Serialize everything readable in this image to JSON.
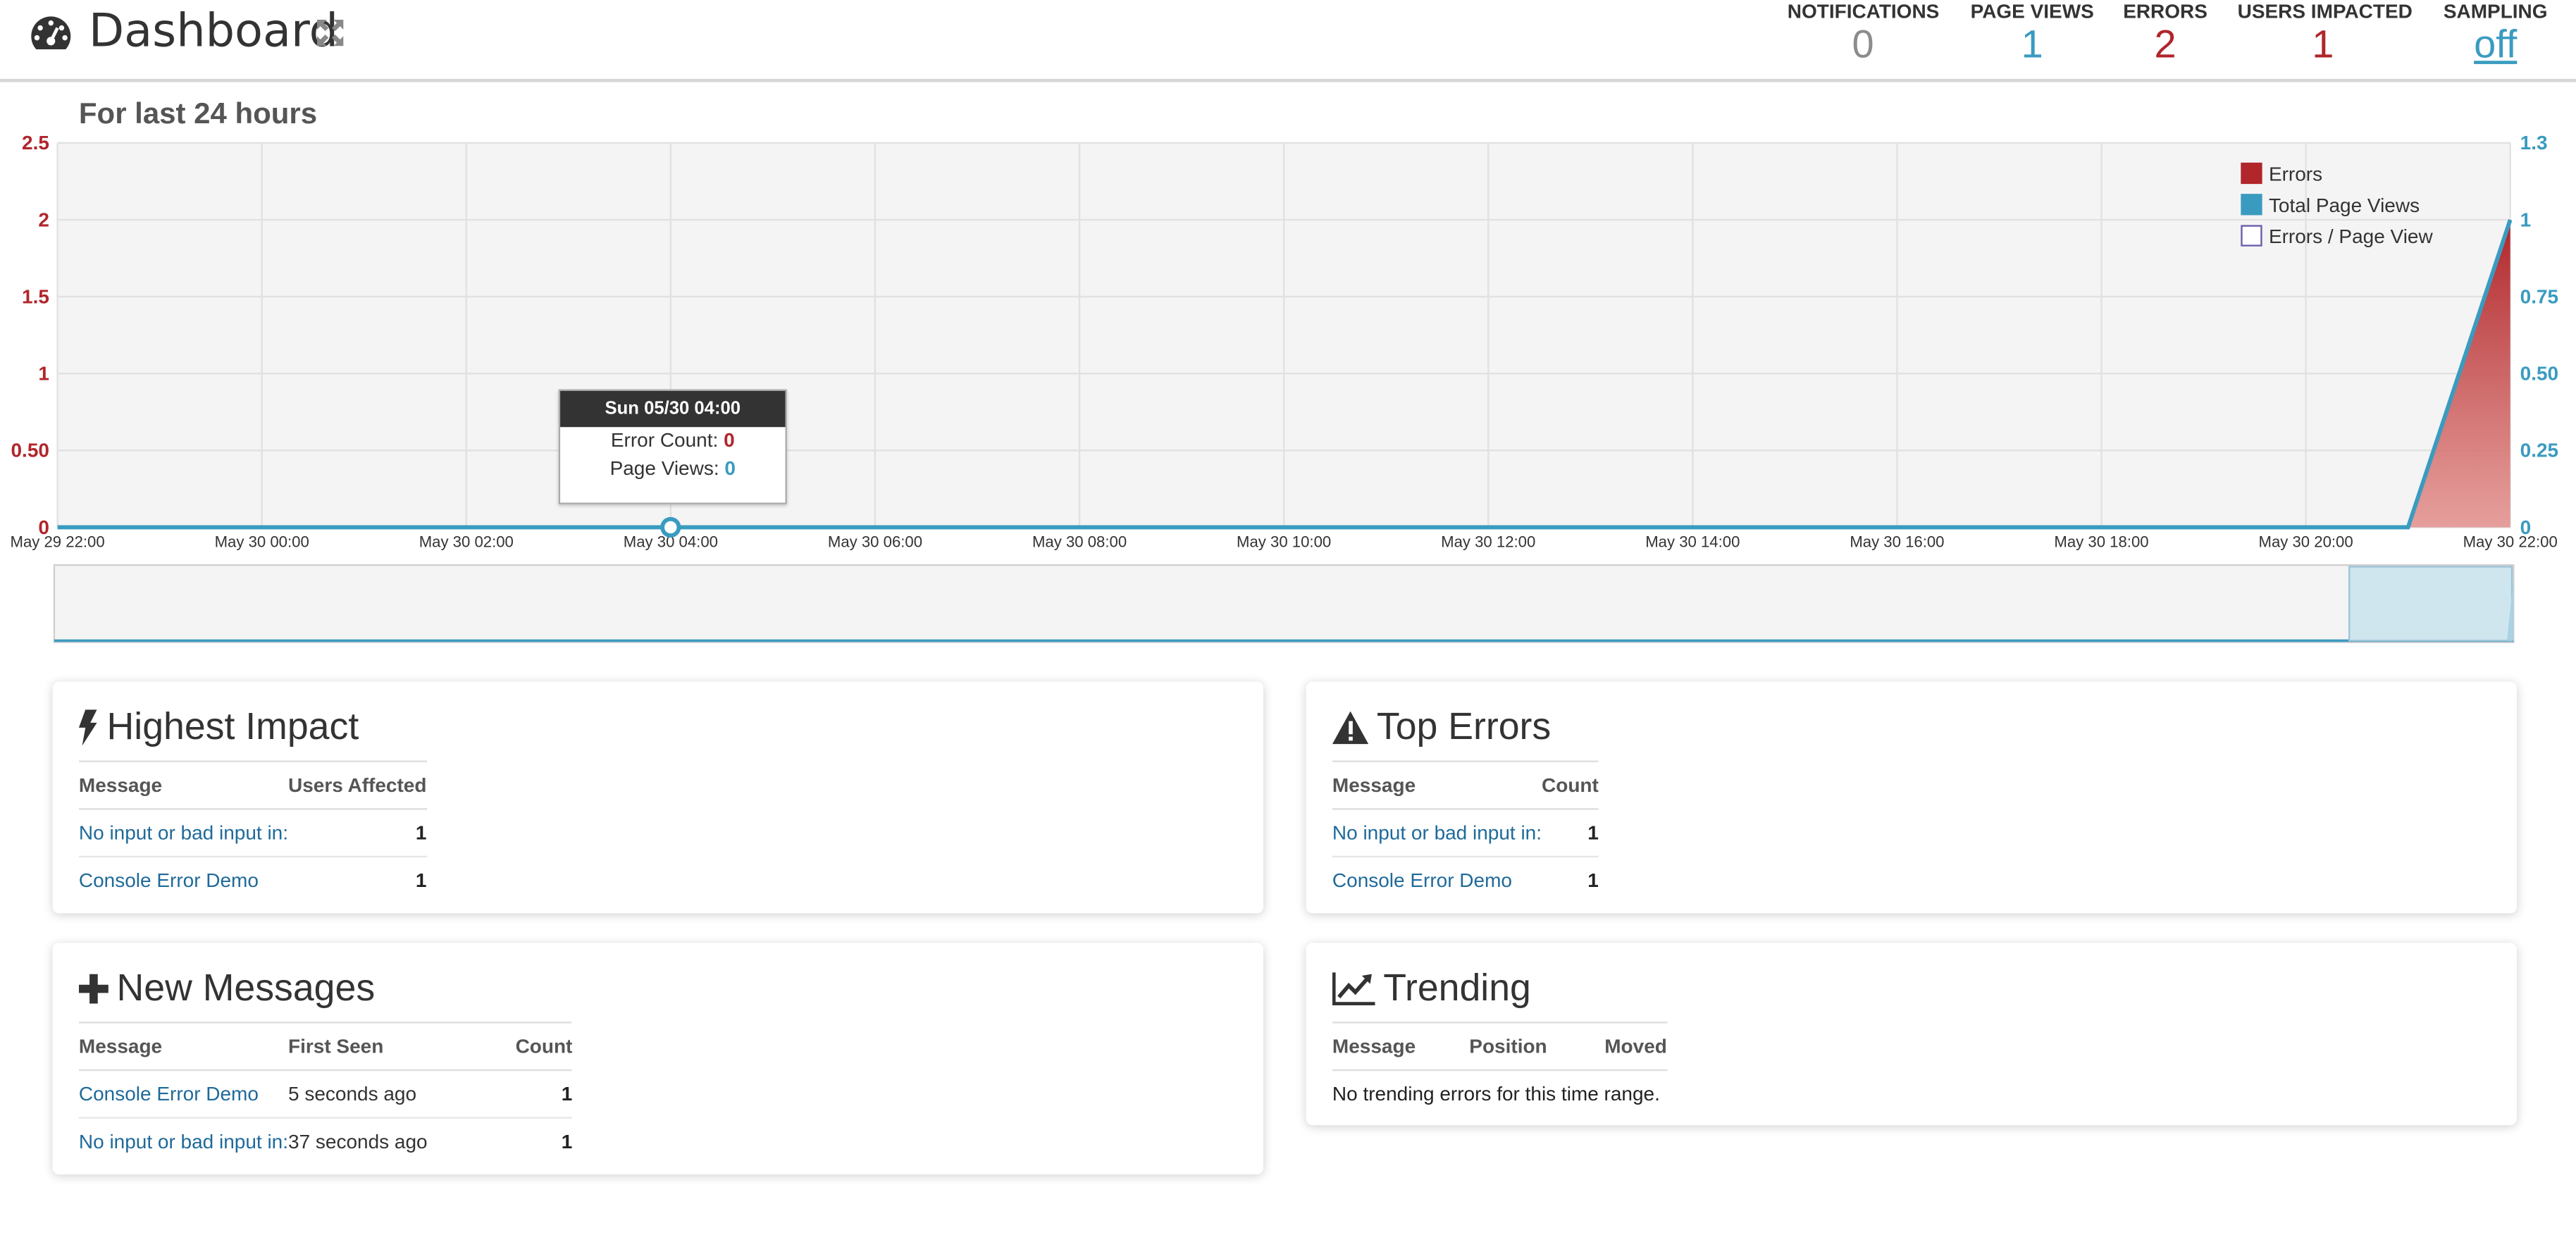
{
  "header": {
    "title": "Dashboard",
    "stats": [
      {
        "label": "NOTIFICATIONS",
        "value": "0"
      },
      {
        "label": "PAGE VIEWS",
        "value": "1"
      },
      {
        "label": "ERRORS",
        "value": "2"
      },
      {
        "label": "USERS IMPACTED",
        "value": "1"
      },
      {
        "label": "SAMPLING",
        "value": "off"
      }
    ],
    "colors": {
      "grey": "#8c8c8c",
      "blue": "#3a9bc0",
      "red": "#b0262b"
    }
  },
  "chart": {
    "title": "For last 24 hours",
    "legend": [
      "Errors",
      "Total Page Views",
      "Errors / Page View"
    ],
    "tooltip": {
      "title": "Sun 05/30 04:00",
      "error_label": "Error Count:",
      "error_value": "0",
      "pv_label": "Page Views:",
      "pv_value": "0"
    }
  },
  "chart_data": {
    "type": "area",
    "x": [
      "May 29 22:00",
      "May 30 00:00",
      "May 30 02:00",
      "May 30 04:00",
      "May 30 06:00",
      "May 30 08:00",
      "May 30 10:00",
      "May 30 12:00",
      "May 30 14:00",
      "May 30 16:00",
      "May 30 18:00",
      "May 30 20:00",
      "May 30 22:00"
    ],
    "x_ticks": [
      "May 29 22:00",
      "May 30 00:00",
      "May 30 02:00",
      "May 30 04:00",
      "May 30 06:00",
      "May 30 08:00",
      "May 30 10:00",
      "May 30 12:00",
      "May 30 14:00",
      "May 30 16:00",
      "May 30 18:00",
      "May 30 20:00",
      "May 30 22:00"
    ],
    "y_left_ticks": [
      "0",
      "0.50",
      "1",
      "1.5",
      "2",
      "2.5"
    ],
    "y_right_ticks": [
      "0",
      "0.25",
      "0.50",
      "0.75",
      "1",
      "1.3"
    ],
    "ylim_left": [
      0,
      2.5
    ],
    "ylim_right": [
      0,
      1.25
    ],
    "points_hours": [
      0,
      23,
      24
    ],
    "series": [
      {
        "name": "Errors",
        "axis": "left",
        "color": "#b0262b",
        "values": [
          0,
          0,
          2
        ]
      },
      {
        "name": "Total Page Views",
        "axis": "right",
        "color": "#3a9bc0",
        "values": [
          0,
          0,
          1
        ]
      },
      {
        "name": "Errors / Page View",
        "axis": "right",
        "color": "#6a5aa8",
        "values": []
      }
    ],
    "grid": true,
    "legend_position": "top-right"
  },
  "panels": {
    "highest_impact": {
      "title": "Highest Impact",
      "columns": [
        "Message",
        "Users Affected"
      ],
      "rows": [
        {
          "message": "No input or bad input in:",
          "count": "1"
        },
        {
          "message": "Console Error Demo",
          "count": "1"
        }
      ]
    },
    "top_errors": {
      "title": "Top Errors",
      "columns": [
        "Message",
        "Count"
      ],
      "rows": [
        {
          "message": "No input or bad input in:",
          "count": "1"
        },
        {
          "message": "Console Error Demo",
          "count": "1"
        }
      ]
    },
    "new_messages": {
      "title": "New Messages",
      "columns": [
        "Message",
        "First Seen",
        "Count"
      ],
      "rows": [
        {
          "message": "Console Error Demo",
          "first_seen": "5 seconds ago",
          "count": "1"
        },
        {
          "message": "No input or bad input in:",
          "first_seen": "37 seconds ago",
          "count": "1"
        }
      ]
    },
    "trending": {
      "title": "Trending",
      "columns": [
        "Message",
        "Position",
        "Moved"
      ],
      "empty": "No trending errors for this time range."
    }
  }
}
